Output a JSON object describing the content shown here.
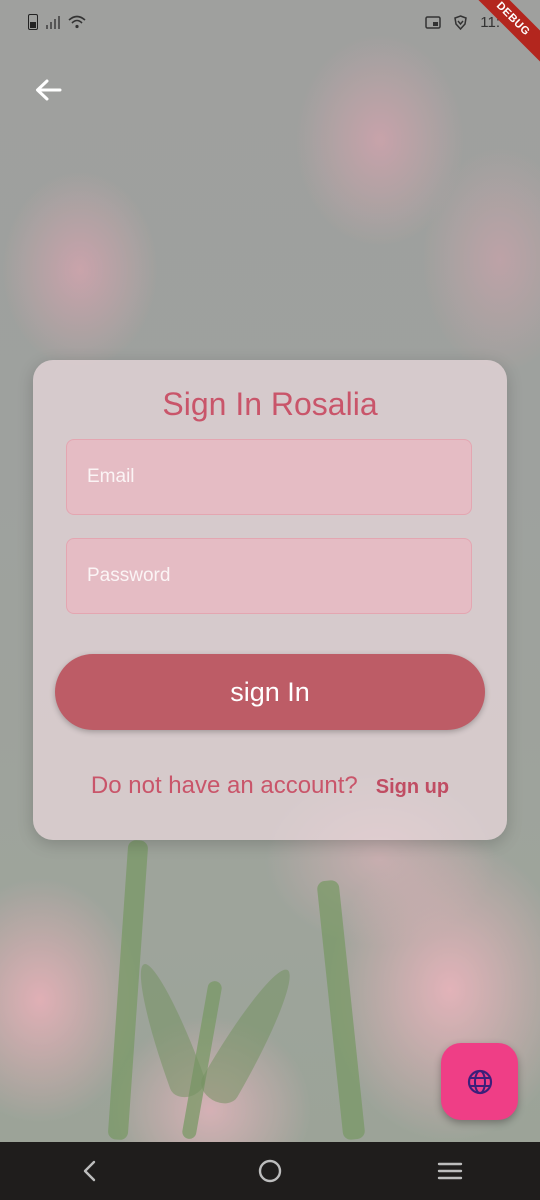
{
  "debug_banner": "DEBUG",
  "status_bar": {
    "time": "11:"
  },
  "card": {
    "title": "Sign In Rosalia",
    "email_placeholder": "Email",
    "password_placeholder": "Password",
    "sign_in_label": "sign In",
    "account_prompt": "Do not have an account?",
    "sign_up_label": "Sign up"
  },
  "icons": {
    "back": "arrow-left-icon",
    "fab": "globe-icon",
    "nav": [
      "back-triangle-icon",
      "home-circle-icon",
      "menu-icon"
    ]
  },
  "colors": {
    "title": "#c9556a",
    "button": "#bd5c66",
    "fab": "#ef3e86",
    "debug": "#b3261e"
  }
}
